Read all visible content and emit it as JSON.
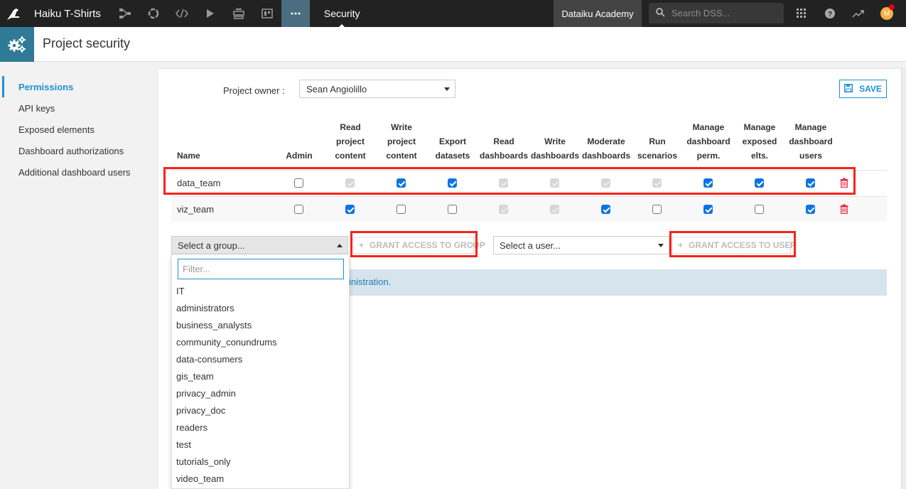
{
  "topnav": {
    "project_name": "Haiku T-Shirts",
    "icons": [
      "flow-icon",
      "lab-icon",
      "code-icon",
      "run-icon",
      "deploy-icon",
      "dashboard-icon",
      "more-icon"
    ],
    "current_section": "Security",
    "academy_label": "Dataiku Academy",
    "search_placeholder": "Search DSS...",
    "avatar_initial": "M",
    "colors": {
      "bar_bg": "#222222",
      "active_bg": "#4a6e80"
    }
  },
  "header": {
    "title": "Project security"
  },
  "sidebar": {
    "items": [
      {
        "label": "Permissions",
        "active": true
      },
      {
        "label": "API keys",
        "active": false
      },
      {
        "label": "Exposed elements",
        "active": false
      },
      {
        "label": "Dashboard authorizations",
        "active": false
      },
      {
        "label": "Additional dashboard users",
        "active": false
      }
    ]
  },
  "owner": {
    "label": "Project owner :",
    "value": "Sean Angiolillo"
  },
  "save_label": "SAVE",
  "table": {
    "columns": [
      [
        "Name"
      ],
      [
        "Admin"
      ],
      [
        "Read",
        "project",
        "content"
      ],
      [
        "Write",
        "project",
        "content"
      ],
      [
        "Export",
        "datasets"
      ],
      [
        "Read",
        "dashboards"
      ],
      [
        "Write",
        "dashboards"
      ],
      [
        "Moderate",
        "dashboards"
      ],
      [
        "Run",
        "scenarios"
      ],
      [
        "Manage",
        "dashboard",
        "perm."
      ],
      [
        "Manage",
        "exposed",
        "elts."
      ],
      [
        "Manage",
        "dashboard",
        "users"
      ]
    ],
    "column_labels": [
      "Name",
      "Admin",
      "Read project content",
      "Write project content",
      "Export datasets",
      "Read dashboards",
      "Write dashboards",
      "Moderate dashboards",
      "Run scenarios",
      "Manage dashboard perm.",
      "Manage exposed elts.",
      "Manage dashboard users"
    ],
    "rows": [
      {
        "name": "data_team",
        "highlighted": true,
        "perms": [
          "unchecked",
          "disabled",
          "checked",
          "checked",
          "disabled",
          "disabled",
          "disabled",
          "disabled",
          "checked",
          "checked",
          "checked"
        ]
      },
      {
        "name": "viz_team",
        "highlighted": false,
        "perms": [
          "unchecked",
          "checked",
          "unchecked",
          "unchecked",
          "disabled",
          "disabled",
          "checked",
          "unchecked",
          "checked",
          "unchecked",
          "checked"
        ]
      }
    ]
  },
  "grant": {
    "group_select_placeholder": "Select a group...",
    "group_button": "GRANT ACCESS TO GROUP",
    "user_select_placeholder": "Select a user...",
    "user_button": "GRANT ACCESS TO USER"
  },
  "info_banner": {
    "visible_text": "inistration."
  },
  "group_dropdown": {
    "filter_placeholder": "Filter...",
    "options": [
      "IT",
      "administrators",
      "business_analysts",
      "community_conundrums",
      "data-consumers",
      "gis_team",
      "privacy_admin",
      "privacy_doc",
      "readers",
      "test",
      "tutorials_only",
      "video_team"
    ]
  },
  "accent_color": "#1e90d6",
  "highlight_color": "#f7231a"
}
